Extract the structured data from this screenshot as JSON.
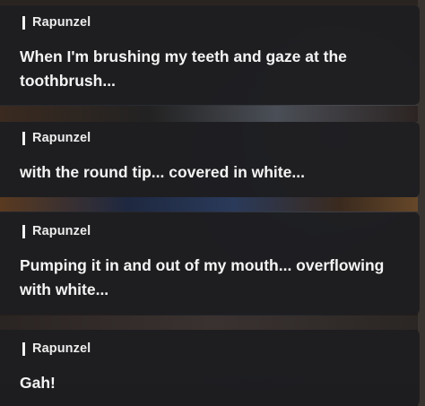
{
  "messages": [
    {
      "speaker": "Rapunzel",
      "text": "When I'm brushing my teeth and gaze at the toothbrush..."
    },
    {
      "speaker": "Rapunzel",
      "text": "with the round tip... covered in white..."
    },
    {
      "speaker": "Rapunzel",
      "text": "Pumping it in and out of my mouth... overflowing with white..."
    },
    {
      "speaker": "Rapunzel",
      "text": "Gah!"
    }
  ]
}
